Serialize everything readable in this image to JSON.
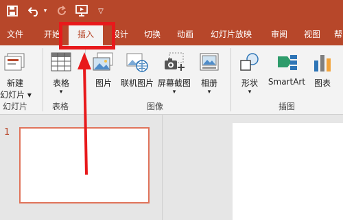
{
  "quick_access": {
    "save": "save-icon",
    "undo": "undo-icon",
    "undo_menu": "▾",
    "redo": "redo-icon",
    "present": "present-from-start-icon",
    "customize": "▽"
  },
  "tabs": [
    {
      "label": "文件"
    },
    {
      "label": "开始"
    },
    {
      "label": "插入",
      "active": true
    },
    {
      "label": "设计"
    },
    {
      "label": "切换"
    },
    {
      "label": "动画"
    },
    {
      "label": "幻灯片放映"
    },
    {
      "label": "审阅"
    },
    {
      "label": "视图"
    },
    {
      "label": "帮"
    }
  ],
  "ribbon": {
    "new_slide": {
      "line1": "新建",
      "line2": "幻灯片 ▾",
      "icon": "new-slide-icon"
    },
    "table": {
      "label": "表格",
      "caret": "▾",
      "icon": "table-icon"
    },
    "pictures": {
      "label": "图片",
      "icon": "pictures-icon"
    },
    "online_pictures": {
      "label": "联机图片",
      "icon": "online-pictures-icon"
    },
    "screenshot": {
      "label": "屏幕截图",
      "caret": "▾",
      "icon": "screenshot-icon"
    },
    "album": {
      "label": "相册",
      "caret": "▾",
      "icon": "photo-album-icon"
    },
    "shapes": {
      "label": "形状",
      "caret": "▾",
      "icon": "shapes-icon"
    },
    "smartart": {
      "label": "SmartArt",
      "icon": "smartart-icon"
    },
    "chart": {
      "label": "图表",
      "icon": "chart-icon"
    },
    "groups": {
      "slides": "幻灯片",
      "tables": "表格",
      "images": "图像",
      "illustrations": "插图"
    }
  },
  "thumbnails": [
    {
      "number": "1"
    }
  ],
  "annotation": {
    "color": "#e8191b"
  },
  "colors": {
    "accent": "#b7472a",
    "ribbon_bg": "#f3f3f3",
    "workspace": "#e6e6e6"
  }
}
